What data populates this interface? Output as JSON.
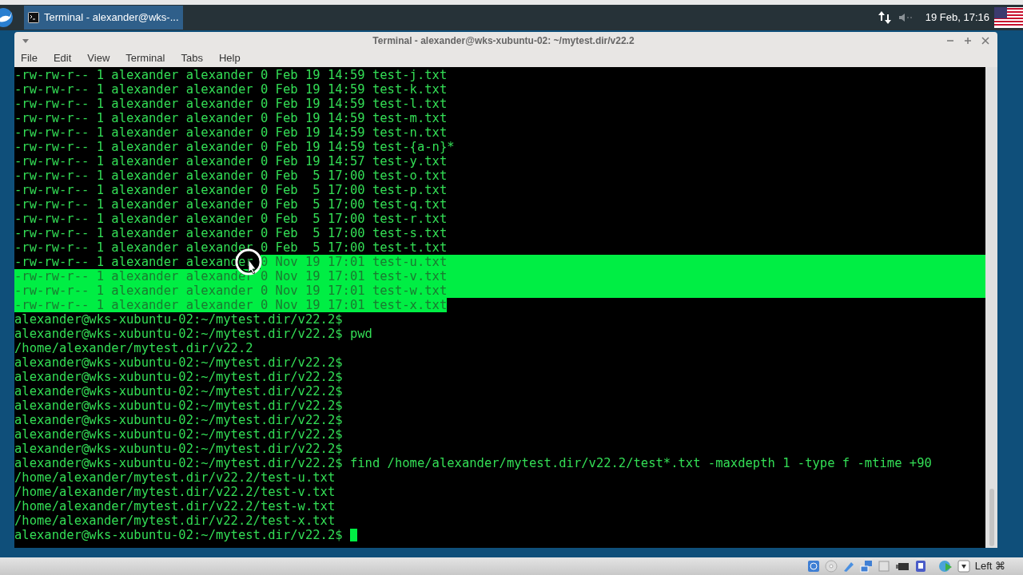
{
  "panel": {
    "task": {
      "title": "Terminal - alexander@wks-...",
      "selected": true
    },
    "clock": "19 Feb, 17:16"
  },
  "window": {
    "title": "Terminal - alexander@wks-xubuntu-02: ~/mytest.dir/v22.2"
  },
  "menu": [
    "File",
    "Edit",
    "View",
    "Terminal",
    "Tabs",
    "Help"
  ],
  "terminal": {
    "lines": [
      {
        "segments": [
          {
            "text": "-rw-rw-r-- 1 alexander alexander 0 Feb 19 14:59 test-j.txt",
            "selected": false
          }
        ],
        "selected_to_edge": false
      },
      {
        "segments": [
          {
            "text": "-rw-rw-r-- 1 alexander alexander 0 Feb 19 14:59 test-k.txt",
            "selected": false
          }
        ],
        "selected_to_edge": false
      },
      {
        "segments": [
          {
            "text": "-rw-rw-r-- 1 alexander alexander 0 Feb 19 14:59 test-l.txt",
            "selected": false
          }
        ],
        "selected_to_edge": false
      },
      {
        "segments": [
          {
            "text": "-rw-rw-r-- 1 alexander alexander 0 Feb 19 14:59 test-m.txt",
            "selected": false
          }
        ],
        "selected_to_edge": false
      },
      {
        "segments": [
          {
            "text": "-rw-rw-r-- 1 alexander alexander 0 Feb 19 14:59 test-n.txt",
            "selected": false
          }
        ],
        "selected_to_edge": false
      },
      {
        "segments": [
          {
            "text": "-rw-rw-r-- 1 alexander alexander 0 Feb 19 14:59 test-{a-n}*",
            "selected": false
          }
        ],
        "selected_to_edge": false
      },
      {
        "segments": [
          {
            "text": "-rw-rw-r-- 1 alexander alexander 0 Feb 19 14:57 test-y.txt",
            "selected": false
          }
        ],
        "selected_to_edge": false
      },
      {
        "segments": [
          {
            "text": "-rw-rw-r-- 1 alexander alexander 0 Feb  5 17:00 test-o.txt",
            "selected": false
          }
        ],
        "selected_to_edge": false
      },
      {
        "segments": [
          {
            "text": "-rw-rw-r-- 1 alexander alexander 0 Feb  5 17:00 test-p.txt",
            "selected": false
          }
        ],
        "selected_to_edge": false
      },
      {
        "segments": [
          {
            "text": "-rw-rw-r-- 1 alexander alexander 0 Feb  5 17:00 test-q.txt",
            "selected": false
          }
        ],
        "selected_to_edge": false
      },
      {
        "segments": [
          {
            "text": "-rw-rw-r-- 1 alexander alexander 0 Feb  5 17:00 test-r.txt",
            "selected": false
          }
        ],
        "selected_to_edge": false
      },
      {
        "segments": [
          {
            "text": "-rw-rw-r-- 1 alexander alexander 0 Feb  5 17:00 test-s.txt",
            "selected": false
          }
        ],
        "selected_to_edge": false
      },
      {
        "segments": [
          {
            "text": "-rw-rw-r-- 1 alexander alexander 0 Feb  5 17:00 test-t.txt",
            "selected": false
          }
        ],
        "selected_to_edge": false
      },
      {
        "segments": [
          {
            "text": "-rw-rw-r-- 1 alexander alexander ",
            "selected": false
          },
          {
            "text": "0 Nov 19 17:01 test-u.txt",
            "selected": true
          }
        ],
        "selected_to_edge": true
      },
      {
        "segments": [
          {
            "text": "-rw-rw-r-- 1 alexander alexander 0 Nov 19 17:01 test-v.txt",
            "selected": true
          }
        ],
        "selected_to_edge": true
      },
      {
        "segments": [
          {
            "text": "-rw-rw-r-- 1 alexander alexander 0 Nov 19 17:01 test-w.txt",
            "selected": true
          }
        ],
        "selected_to_edge": true
      },
      {
        "segments": [
          {
            "text": "-rw-rw-r-- 1 alexander alexander 0 Nov 19 17:01 test-x.txt",
            "selected": true
          }
        ],
        "selected_to_edge": false
      },
      {
        "segments": [
          {
            "text": "alexander@wks-xubuntu-02:~/mytest.dir/v22.2$",
            "selected": false
          }
        ],
        "selected_to_edge": false
      },
      {
        "segments": [
          {
            "text": "alexander@wks-xubuntu-02:~/mytest.dir/v22.2$ pwd",
            "selected": false
          }
        ],
        "selected_to_edge": false
      },
      {
        "segments": [
          {
            "text": "/home/alexander/mytest.dir/v22.2",
            "selected": false
          }
        ],
        "selected_to_edge": false
      },
      {
        "segments": [
          {
            "text": "alexander@wks-xubuntu-02:~/mytest.dir/v22.2$",
            "selected": false
          }
        ],
        "selected_to_edge": false
      },
      {
        "segments": [
          {
            "text": "alexander@wks-xubuntu-02:~/mytest.dir/v22.2$",
            "selected": false
          }
        ],
        "selected_to_edge": false
      },
      {
        "segments": [
          {
            "text": "alexander@wks-xubuntu-02:~/mytest.dir/v22.2$",
            "selected": false
          }
        ],
        "selected_to_edge": false
      },
      {
        "segments": [
          {
            "text": "alexander@wks-xubuntu-02:~/mytest.dir/v22.2$",
            "selected": false
          }
        ],
        "selected_to_edge": false
      },
      {
        "segments": [
          {
            "text": "alexander@wks-xubuntu-02:~/mytest.dir/v22.2$",
            "selected": false
          }
        ],
        "selected_to_edge": false
      },
      {
        "segments": [
          {
            "text": "alexander@wks-xubuntu-02:~/mytest.dir/v22.2$",
            "selected": false
          }
        ],
        "selected_to_edge": false
      },
      {
        "segments": [
          {
            "text": "alexander@wks-xubuntu-02:~/mytest.dir/v22.2$",
            "selected": false
          }
        ],
        "selected_to_edge": false
      },
      {
        "segments": [
          {
            "text": "alexander@wks-xubuntu-02:~/mytest.dir/v22.2$ find /home/alexander/mytest.dir/v22.2/test*.txt -maxdepth 1 -type f -mtime +90",
            "selected": false
          }
        ],
        "selected_to_edge": false
      },
      {
        "segments": [
          {
            "text": "/home/alexander/mytest.dir/v22.2/test-u.txt",
            "selected": false
          }
        ],
        "selected_to_edge": false
      },
      {
        "segments": [
          {
            "text": "/home/alexander/mytest.dir/v22.2/test-v.txt",
            "selected": false
          }
        ],
        "selected_to_edge": false
      },
      {
        "segments": [
          {
            "text": "/home/alexander/mytest.dir/v22.2/test-w.txt",
            "selected": false
          }
        ],
        "selected_to_edge": false
      },
      {
        "segments": [
          {
            "text": "/home/alexander/mytest.dir/v22.2/test-x.txt",
            "selected": false
          }
        ],
        "selected_to_edge": false
      },
      {
        "segments": [
          {
            "text": "alexander@wks-xubuntu-02:~/mytest.dir/v22.2$ ",
            "selected": false
          }
        ],
        "selected_to_edge": false,
        "cursor": true
      }
    ]
  },
  "vm_status": {
    "host_key": "Left ⌘"
  }
}
